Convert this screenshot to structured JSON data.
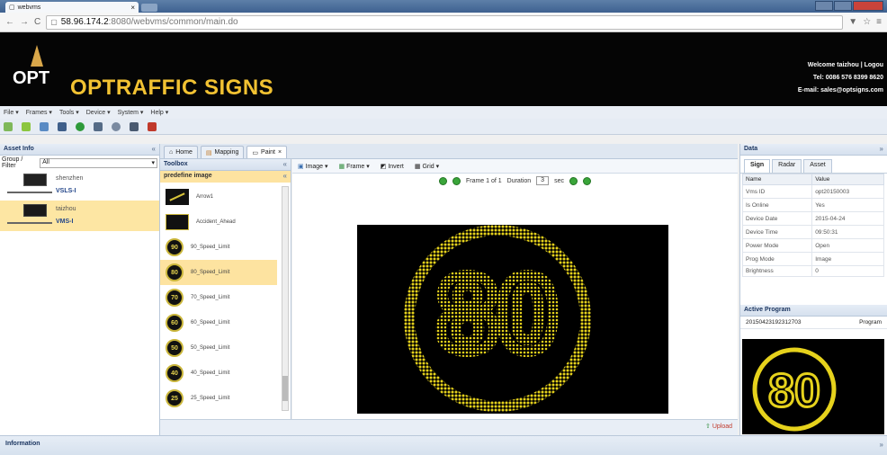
{
  "browser": {
    "tab_title": "webvms",
    "url_host": "58.96.174.2",
    "url_path": ":8080/webvms/common/main.do"
  },
  "brand": {
    "logo_text": "OPT",
    "name": "OPTRAFFIC SIGNS",
    "welcome": "Welcome taizhou  |  Logou",
    "tel": "Tel: 0086 576 8399 8620",
    "email": "E-mail: sales@optsigns.com"
  },
  "menu": [
    "File ▾",
    "Frames ▾",
    "Tools ▾",
    "Device ▾",
    "System ▾",
    "Help ▾"
  ],
  "asset": {
    "title": "Asset Info",
    "filter_label": "Group / Filter",
    "filter_value": "All",
    "items": [
      {
        "name": "shenzhen",
        "code": "VSLS-I"
      },
      {
        "name": "taizhou",
        "code": "VMS-I"
      }
    ]
  },
  "tabs": {
    "home": "Home",
    "mapping": "Mapping",
    "paint": "Paint"
  },
  "toolbox": {
    "title": "Toolbox",
    "section": "predefine image",
    "items": [
      {
        "label": "Arrow1",
        "kind": "arrow"
      },
      {
        "label": "Accident_Ahead",
        "kind": "accident"
      },
      {
        "label": "90_Speed_Limit",
        "speed": "90"
      },
      {
        "label": "80_Speed_Limit",
        "speed": "80"
      },
      {
        "label": "70_Speed_Limit",
        "speed": "70"
      },
      {
        "label": "60_Speed_Limit",
        "speed": "60"
      },
      {
        "label": "50_Speed_Limit",
        "speed": "50"
      },
      {
        "label": "40_Speed_Limit",
        "speed": "40"
      },
      {
        "label": "25_Speed_Limit",
        "speed": "25"
      }
    ]
  },
  "editor": {
    "image_btn": "Image ▾",
    "frame_btn": "Frame ▾",
    "invert_btn": "Invert",
    "grid_btn": "Grid ▾",
    "frame_label": "Frame 1 of 1",
    "duration_label": "Duration",
    "duration_value": "3",
    "sec_label": "sec",
    "sign_text": "80",
    "upload_label": "Upload"
  },
  "data_panel": {
    "title": "Data",
    "tabs": [
      "Sign",
      "Radar",
      "Asset"
    ],
    "headers": [
      "Name",
      "Value"
    ],
    "rows": [
      [
        "Vms ID",
        "opt20150003"
      ],
      [
        "Is Online",
        "Yes"
      ],
      [
        "Device Date",
        "2015-04-24"
      ],
      [
        "Device Time",
        "09:50:31"
      ],
      [
        "Power Mode",
        "Open"
      ],
      [
        "Prog Mode",
        "Image"
      ],
      [
        "Brightness",
        "0"
      ]
    ]
  },
  "active_program": {
    "title": "Active Program",
    "id": "20150423192312703",
    "type": "Program",
    "preview_text": "80"
  },
  "info": {
    "title": "Information"
  },
  "colors": {
    "brand_yellow": "#f2c232",
    "led": "#e6d21c",
    "selection": "#fde3a0"
  }
}
